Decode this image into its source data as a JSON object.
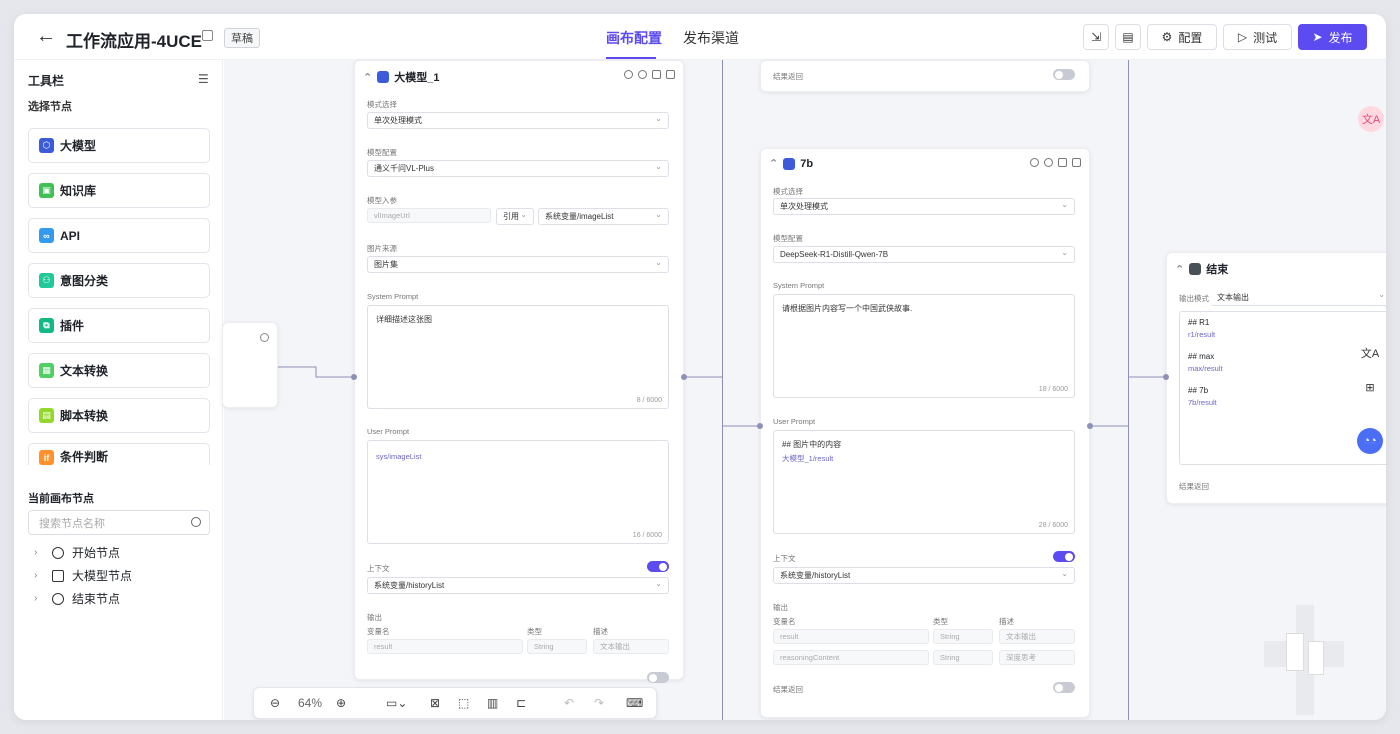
{
  "header": {
    "title": "工作流应用-4UCE",
    "badge": "草稿",
    "tabs": [
      "画布配置",
      "发布渠道"
    ],
    "config_label": "配置",
    "test_label": "测试",
    "publish_label": "发布"
  },
  "sidebar": {
    "title": "工具栏",
    "subtitle": "选择节点",
    "tools": [
      {
        "label": "大模型",
        "color": "#3b5bdb"
      },
      {
        "label": "知识库",
        "color": "#40c057"
      },
      {
        "label": "API",
        "color": "#339af0"
      },
      {
        "label": "意图分类",
        "color": "#20c997"
      },
      {
        "label": "插件",
        "color": "#12b886"
      },
      {
        "label": "文本转换",
        "color": "#51cf66"
      },
      {
        "label": "脚本转换",
        "color": "#94d82d"
      },
      {
        "label": "条件判断",
        "color": "#ff922b"
      }
    ],
    "current_title": "当前画布节点",
    "search_placeholder": "搜索节点名称",
    "tree": [
      "开始节点",
      "大模型节点",
      "结束节点"
    ]
  },
  "node1": {
    "title": "大模型_1",
    "mode_label": "模式选择",
    "mode": "单次处理模式",
    "model_label": "模型配置",
    "model": "通义千问VL-Plus",
    "input_label": "模型入参",
    "input_var": "vlImageUrl",
    "ref": "引用",
    "ref_value": "系统变量/imageList",
    "img_label": "图片来源",
    "img": "图片集",
    "sys_label": "System Prompt",
    "sys_text": "详细描述这张图",
    "sys_count": "8 / 6000",
    "user_label": "User Prompt",
    "user_ref": "sys/imageList",
    "user_count": "16 / 6000",
    "ctx_label": "上下文",
    "ctx_value": "系统变量/historyList",
    "out_label": "输出",
    "col_name": "变量名",
    "col_type": "类型",
    "col_desc": "描述",
    "out_var": "result",
    "out_type": "String",
    "out_desc": "文本输出"
  },
  "top_node": {
    "label": "结果返回"
  },
  "node2": {
    "title": "7b",
    "mode_label": "模式选择",
    "mode": "单次处理模式",
    "model_label": "模型配置",
    "model": "DeepSeek-R1-Distill-Qwen-7B",
    "sys_label": "System Prompt",
    "sys_text": "请根据图片内容写一个中国武侠故事.",
    "sys_count": "18 / 6000",
    "user_label": "User Prompt",
    "user_text": "## 图片中的内容",
    "user_ref": "大模型_1/result",
    "user_count": "28 / 6000",
    "ctx_label": "上下文",
    "ctx_value": "系统变量/historyList",
    "out_label": "输出",
    "col_name": "变量名",
    "col_type": "类型",
    "col_desc": "描述",
    "rows": [
      {
        "var": "result",
        "type": "String",
        "desc": "文本输出"
      },
      {
        "var": "reasoningContent",
        "type": "String",
        "desc": "深度思考"
      }
    ],
    "return_label": "结果返回"
  },
  "end_node": {
    "title": "结束",
    "mode_label": "输出模式",
    "mode": "文本输出",
    "items": [
      {
        "h": "## R1",
        "ref": "r1/result"
      },
      {
        "h": "## max",
        "ref": "max/result"
      },
      {
        "h": "## 7b",
        "ref": "7b/result"
      }
    ],
    "return_label": "结果返回"
  },
  "zoom": {
    "level": "64%"
  }
}
